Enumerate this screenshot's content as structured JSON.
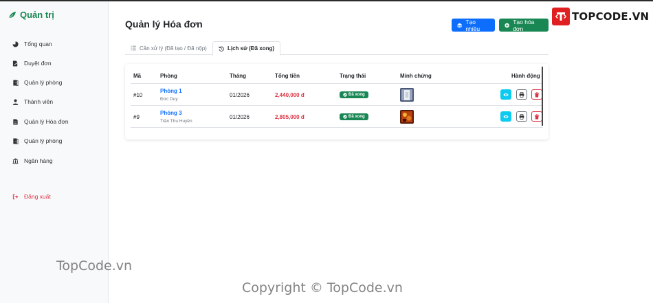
{
  "sidebar": {
    "brand": "Quản trị",
    "items": [
      {
        "label": "Tổng quan",
        "icon": "pie-chart-icon"
      },
      {
        "label": "Duyệt đơn",
        "icon": "file-signature-icon"
      },
      {
        "label": "Quản lý phòng",
        "icon": "door-icon"
      },
      {
        "label": "Thành viên",
        "icon": "user-icon"
      },
      {
        "label": "Quản lý Hóa đơn",
        "icon": "invoice-icon"
      },
      {
        "label": "Quản lý phòng",
        "icon": "door-icon"
      },
      {
        "label": "Ngân hàng",
        "icon": "bank-icon"
      }
    ],
    "logout": "Đăng xuất"
  },
  "header": {
    "title": "Quản lý Hóa đơn",
    "btn_bulk": "Tạo nhiều",
    "btn_create": "Tạo hóa đơn"
  },
  "tabs": [
    {
      "label": "Cần xử lý (Đã tạo / Đã nộp)",
      "active": false
    },
    {
      "label": "Lịch sử (Đã xong)",
      "active": true
    }
  ],
  "table": {
    "columns": [
      "Mã",
      "Phòng",
      "Tháng",
      "Tổng tiền",
      "Trạng thái",
      "Minh chứng",
      "Hành động"
    ],
    "rows": [
      {
        "id": "#10",
        "room": "Phòng 1",
        "tenant": "Đức Duy",
        "month": "01/2026",
        "total": "2,440,000 đ",
        "status": "Đã xong"
      },
      {
        "id": "#9",
        "room": "Phòng 3",
        "tenant": "Trần Thu Huyền",
        "month": "01/2026",
        "total": "2,805,000 đ",
        "status": "Đã xong"
      }
    ]
  },
  "watermark": {
    "logo": "TOPCODE.VN",
    "text1": "TopCode.vn",
    "text2": "Copyright © TopCode.vn"
  },
  "colors": {
    "primary": "#0d6efd",
    "success": "#198754",
    "danger": "#dc3545",
    "info": "#0dcaf0"
  }
}
